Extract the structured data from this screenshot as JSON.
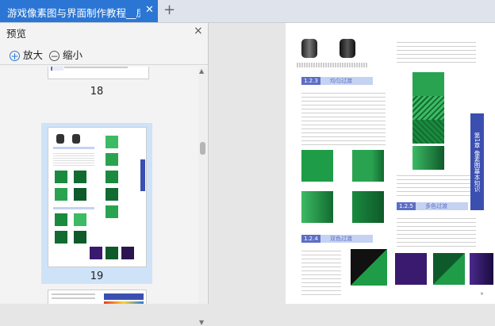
{
  "tab": {
    "title": "游戏像素图与界面制作教程__房…",
    "close": "✕"
  },
  "new_tab": "+",
  "panel": {
    "title": "预览",
    "close": "×",
    "zoom_in": "放大",
    "zoom_out": "缩小",
    "pages": [
      "18",
      "19"
    ],
    "selected_page": "19"
  },
  "document": {
    "section_123_num": "1.2.3",
    "section_123_title": "均匀过渡",
    "section_124_num": "1.2.4",
    "section_124_title": "双色过渡",
    "section_125_num": "1.2.5",
    "section_125_title": "多色过渡",
    "chapter_tab": "第1章 像素图基本知识",
    "page_number": "9",
    "colors": {
      "green_dark": "#0f5a2a",
      "green_light": "#3cba64",
      "purple": "#3a1a6e",
      "accent": "#3a4fb0"
    }
  }
}
